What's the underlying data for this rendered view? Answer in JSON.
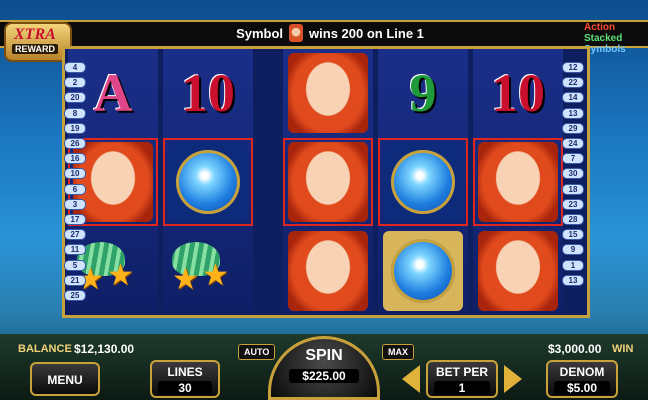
{
  "header": {
    "win_before": "Symbol",
    "win_after": "wins 200 on Line 1",
    "logo_left_top": "XTRA",
    "logo_left_bottom": "REWARD",
    "logo_right": [
      "Action",
      "Stacked",
      "Symbols"
    ]
  },
  "reels": [
    [
      "A",
      "face",
      "shell-stars"
    ],
    [
      "10",
      "orb",
      "shell-stars"
    ],
    [
      "face",
      "face",
      "face"
    ],
    [
      "9",
      "orb",
      "orb"
    ],
    [
      "10",
      "face",
      "face"
    ]
  ],
  "paylines_left": [
    "4",
    "2",
    "20",
    "8",
    "19",
    "26",
    "16",
    "10",
    "6",
    "3",
    "17",
    "27",
    "11",
    "5",
    "21",
    "25"
  ],
  "paylines_right": [
    "12",
    "22",
    "14",
    "13",
    "29",
    "24",
    "7",
    "30",
    "18",
    "23",
    "28",
    "15",
    "9",
    "1",
    "13"
  ],
  "footer": {
    "balance_label": "BALANCE",
    "balance_value": "$12,130.00",
    "win_value": "$3,000.00",
    "win_label": "WIN",
    "menu_label": "MENU",
    "lines_label": "LINES",
    "lines_value": "30",
    "auto_label": "AUTO",
    "spin_label": "SPIN",
    "spin_value": "$225.00",
    "max_label": "MAX",
    "bet_label": "BET PER",
    "bet_value": "1",
    "denom_label": "DENOM",
    "denom_value": "$5.00"
  },
  "colors": {
    "gold": "#c9a13a",
    "highlight": "#e0251f"
  }
}
